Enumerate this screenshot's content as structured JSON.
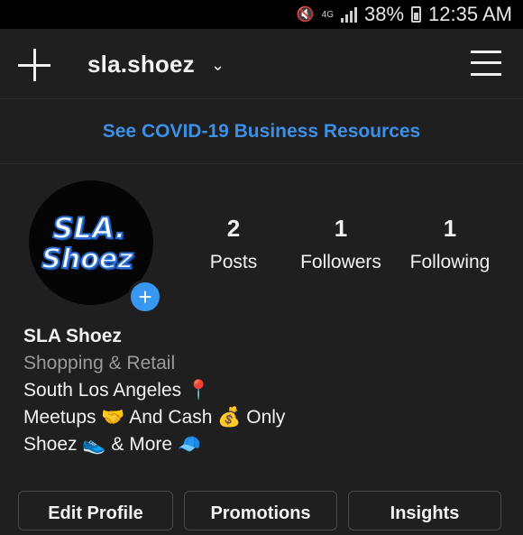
{
  "status_bar": {
    "battery": "38%",
    "time": "12:35 AM",
    "icons": [
      "mute-icon",
      "data-icon",
      "signal-icon",
      "battery-icon"
    ]
  },
  "header": {
    "username": "sla.shoez",
    "icons": [
      "new-post-plus-icon",
      "chevron-down-icon",
      "hamburger-menu-icon"
    ]
  },
  "banner": {
    "link_text": "See COVID-19 Business Resources",
    "color": "#3b8fe6"
  },
  "profile": {
    "avatar_logo_line1": "SLA.",
    "avatar_logo_line2": "Shoez",
    "stats": [
      {
        "value": "2",
        "label": "Posts"
      },
      {
        "value": "1",
        "label": "Followers"
      },
      {
        "value": "1",
        "label": "Following"
      }
    ],
    "name": "SLA Shoez",
    "category": "Shopping & Retail",
    "bio_lines": [
      "South Los Angeles 📍",
      "Meetups 🤝 And Cash 💰 Only",
      "Shoez 👟 & More 🧢"
    ]
  },
  "actions": {
    "edit_profile": "Edit Profile",
    "promotions": "Promotions",
    "insights": "Insights"
  },
  "colors": {
    "background": "#1f1f1f",
    "accent": "#3897f0"
  }
}
